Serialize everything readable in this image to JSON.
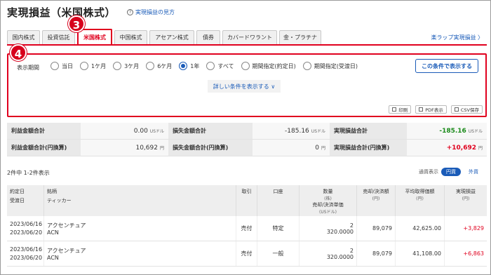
{
  "header": {
    "title": "実現損益（米国株式）",
    "help_link": "実現損益の見方"
  },
  "tabs": [
    {
      "label": "国内株式"
    },
    {
      "label": "投資信託"
    },
    {
      "label": "米国株式"
    },
    {
      "label": "中国株式"
    },
    {
      "label": "アセアン株式"
    },
    {
      "label": "債券"
    },
    {
      "label": "カバードワラント"
    },
    {
      "label": "金・プラチナ"
    }
  ],
  "raku_wrap_link": "楽ラップ実現損益 〉",
  "badges": {
    "step3": "3",
    "step4": "4"
  },
  "conditions": {
    "period_label": "表示期間",
    "options": [
      {
        "label": "当日",
        "selected": false
      },
      {
        "label": "1ケ月",
        "selected": false
      },
      {
        "label": "3ケ月",
        "selected": false
      },
      {
        "label": "6ケ月",
        "selected": false
      },
      {
        "label": "1年",
        "selected": true
      },
      {
        "label": "すべて",
        "selected": false
      },
      {
        "label": "期間指定(約定日)",
        "selected": false
      },
      {
        "label": "期間指定(受渡日)",
        "selected": false
      }
    ],
    "apply_button": "この条件で表示する",
    "more_conditions": "詳しい条件を表示する ∨",
    "export": {
      "print": "印刷",
      "pdf": "PDF表示",
      "csv": "CSV保存"
    }
  },
  "summary": {
    "row1": {
      "profit_label": "利益金額合計",
      "profit_value": "0.00",
      "profit_unit": "USドル",
      "loss_label": "損失金額合計",
      "loss_value": "-185.16",
      "loss_unit": "USドル",
      "realized_label": "実現損益合計",
      "realized_value": "-185.16",
      "realized_unit": "USドル"
    },
    "row2": {
      "profit_label": "利益金額合計(円換算)",
      "profit_value": "10,692",
      "profit_unit": "円",
      "loss_label": "損失金額合計(円換算)",
      "loss_value": "0",
      "loss_unit": "円",
      "realized_label": "実現損益合計(円換算)",
      "realized_value": "+10,692",
      "realized_unit": "円"
    }
  },
  "list": {
    "count": "2件中 1-2件表示",
    "currency_label": "通貨表示",
    "currency_yen": "円貨",
    "currency_foreign": "外貨"
  },
  "columns": {
    "trade_date": "約定日",
    "settle_date": "受渡日",
    "name": "銘柄",
    "ticker": "ティッカー",
    "side": "取引",
    "account": "口座",
    "qty": "数量",
    "qty_unit": "(株)",
    "price": "売却/決済単価",
    "price_unit": "(USドル)",
    "proceeds": "売却/決済額",
    "proceeds_unit": "(円)",
    "avg_cost": "平均取得価額",
    "avg_cost_unit": "(円)",
    "pnl": "実現損益",
    "pnl_unit": "(円)"
  },
  "rows": [
    {
      "trade_date": "2023/06/16",
      "settle_date": "2023/06/20",
      "name": "アクセンチュア",
      "ticker": "ACN",
      "side": "売付",
      "account": "特定",
      "qty": "2",
      "price": "320.0000",
      "proceeds": "89,079",
      "avg_cost": "42,625.00",
      "pnl": "+3,829"
    },
    {
      "trade_date": "2023/06/16",
      "settle_date": "2023/06/20",
      "name": "アクセンチュア",
      "ticker": "ACN",
      "side": "売付",
      "account": "一般",
      "qty": "2",
      "price": "320.0000",
      "proceeds": "89,079",
      "avg_cost": "41,108.00",
      "pnl": "+6,863"
    }
  ],
  "colors": {
    "accent": "#e0001e",
    "link": "#1a5bb8",
    "positive": "#e0001e",
    "negative": "#1a8a1a"
  }
}
